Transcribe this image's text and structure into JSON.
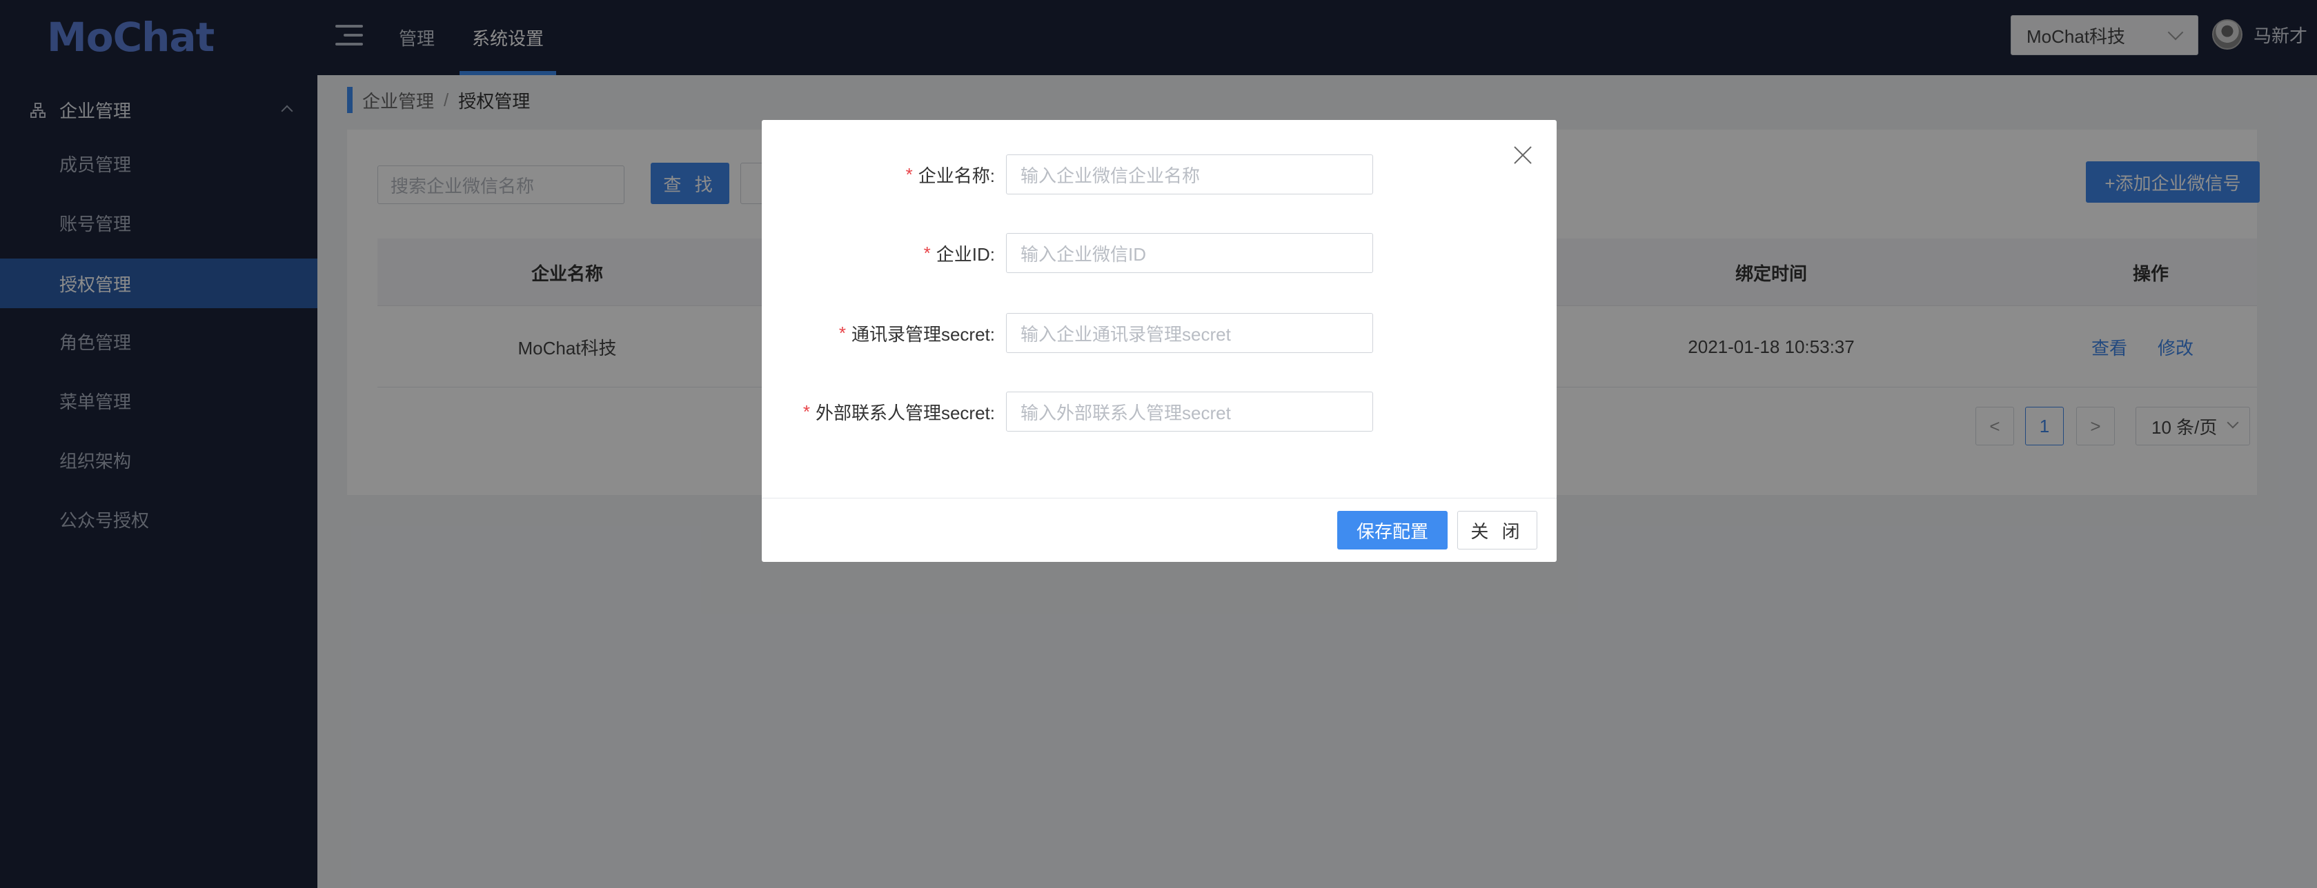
{
  "header": {
    "logo": "MoChat",
    "nav": [
      {
        "label": "管理"
      },
      {
        "label": "系统设置"
      }
    ],
    "company_select": "MoChat科技",
    "user_name": "马新才"
  },
  "sidebar": {
    "group_label": "企业管理",
    "items": [
      {
        "label": "成员管理"
      },
      {
        "label": "账号管理"
      },
      {
        "label": "授权管理"
      },
      {
        "label": "角色管理"
      },
      {
        "label": "菜单管理"
      },
      {
        "label": "组织架构"
      },
      {
        "label": "公众号授权"
      }
    ]
  },
  "breadcrumb": {
    "parent": "企业管理",
    "separator": "/",
    "current": "授权管理"
  },
  "toolbar": {
    "search_placeholder": "搜索企业微信名称",
    "search_button": "查 找",
    "add_button": "+添加企业微信号"
  },
  "table": {
    "columns": [
      "企业名称",
      "绑定时间",
      "操作"
    ],
    "rows": [
      {
        "name": "MoChat科技",
        "bind_time": "2021-01-18 10:53:37",
        "action_view": "查看",
        "action_edit": "修改"
      }
    ]
  },
  "pagination": {
    "prev": "<",
    "current_page": "1",
    "next": ">",
    "page_size": "10 条/页"
  },
  "modal": {
    "fields": [
      {
        "required": "*",
        "label": "企业名称:",
        "placeholder": "输入企业微信企业名称"
      },
      {
        "required": "*",
        "label": "企业ID:",
        "placeholder": "输入企业微信ID"
      },
      {
        "required": "*",
        "label": "通讯录管理secret:",
        "placeholder": "输入企业通讯录管理secret"
      },
      {
        "required": "*",
        "label": "外部联系人管理secret:",
        "placeholder": "输入外部联系人管理secret"
      }
    ],
    "save_button": "保存配置",
    "close_button": "关 闭"
  },
  "icons": {
    "menu_toggle": "menu-fold-icon",
    "sidebar_group": "apartment-icon",
    "modal_close": "close-icon"
  },
  "colors": {
    "header_bg": "#1c2339",
    "accent": "#3f8cf0",
    "sidebar_active": "#2d5ea8",
    "required": "#e8454a"
  }
}
